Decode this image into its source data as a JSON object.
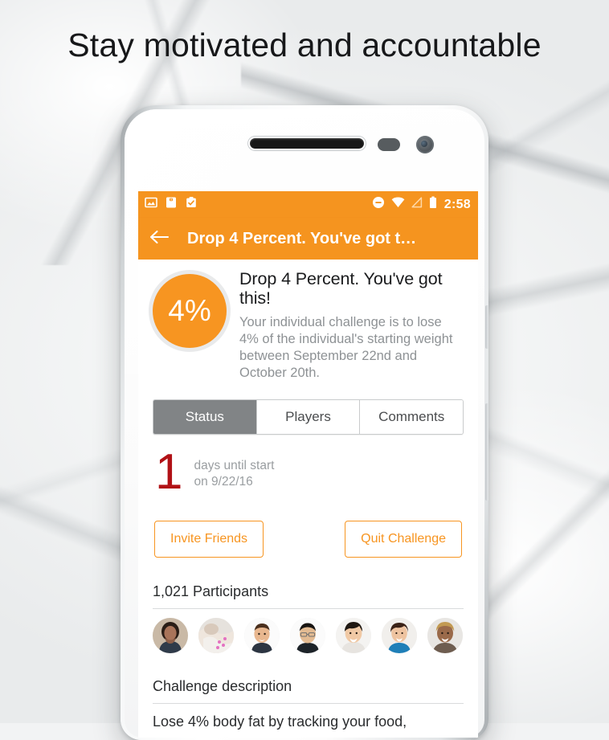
{
  "promo": {
    "headline": "Stay motivated and accountable"
  },
  "phone": {
    "hardware": {
      "earpiece": "earpiece-speaker",
      "sensor": "proximity-sensor",
      "camera": "front-camera",
      "power_button": "power-button",
      "volume_button": "volume-rocker"
    }
  },
  "statusbar": {
    "left_icons": [
      "image-icon",
      "scale-icon",
      "clipboard-check-icon"
    ],
    "right_icons": [
      "do-not-disturb-icon",
      "wifi-icon",
      "cell-signal-icon",
      "battery-icon"
    ],
    "time": "2:58"
  },
  "appbar": {
    "back_icon": "back-arrow-icon",
    "title": "Drop 4 Percent. You've got t…"
  },
  "hero": {
    "badge": "4%",
    "title": "Drop 4 Percent. You've got this!",
    "description": "Your individual challenge is to lose 4% of the individual's starting weight between September 22nd and October 20th."
  },
  "tabs": [
    {
      "label": "Status",
      "active": true
    },
    {
      "label": "Players",
      "active": false
    },
    {
      "label": "Comments",
      "active": false
    }
  ],
  "countdown": {
    "number": "1",
    "line1": "days until start",
    "line2": "on 9/22/16"
  },
  "actions": {
    "invite": "Invite Friends",
    "quit": "Quit Challenge"
  },
  "participants": {
    "title": "1,021 Participants",
    "avatars": [
      {
        "name": "participant-avatar-1"
      },
      {
        "name": "participant-avatar-2"
      },
      {
        "name": "participant-avatar-3"
      },
      {
        "name": "participant-avatar-4"
      },
      {
        "name": "participant-avatar-5"
      },
      {
        "name": "participant-avatar-6"
      },
      {
        "name": "participant-avatar-7"
      }
    ]
  },
  "challenge_description": {
    "title": "Challenge description",
    "body": "Lose 4% body fat by tracking your food,"
  },
  "colors": {
    "brand_orange": "#f5941f",
    "badge_orange": "#f79521",
    "countdown_red": "#b11116",
    "tab_active_gray": "#818486",
    "muted_text": "#8e9295"
  }
}
